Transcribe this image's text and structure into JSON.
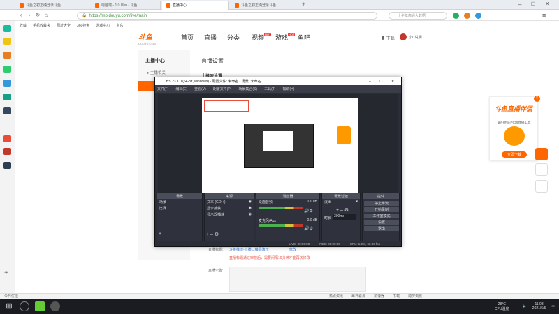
{
  "browser": {
    "tabs": [
      {
        "label": "斗鱼之初正确登录斗鱼"
      },
      {
        "label": "电脑端 - 1.0 Ubu - 斗鱼"
      },
      {
        "label": "直播中心"
      },
      {
        "label": "斗鱼之初正确登录斗鱼"
      }
    ],
    "url": "https://mp.douyu.com/live/main",
    "search_placeholder": "上半年高通大数据",
    "bookmarks": [
      "收藏",
      "手机收藏夹",
      "网址大全",
      "360搜索",
      "游戏中心",
      "京东"
    ]
  },
  "douyu": {
    "logo_text": "斗鱼",
    "logo_sub": "DOUYU.COM",
    "nav": [
      "首页",
      "直播",
      "分类",
      "视频",
      "游戏",
      "鱼吧"
    ],
    "hot_badge": "HOT",
    "download": "下载",
    "user": "小C说明"
  },
  "sidebar": {
    "title": "主播中心",
    "items": [
      "主播相关"
    ]
  },
  "main": {
    "section_title": "直播设置",
    "sub_title": "推流设置"
  },
  "obs": {
    "title": "OBS 23.1.0 (64-bit, windows) - 配置文件: 未命名 - 场景: 未命名",
    "menu": [
      "文件(F)",
      "编辑(E)",
      "查看(V)",
      "配置文件(P)",
      "场景集合(S)",
      "工具(T)",
      "帮助(H)"
    ],
    "docks": {
      "scenes": {
        "title": "场景",
        "items": [
          "场景",
          "比赛"
        ]
      },
      "sources": {
        "title": "来源",
        "items": [
          "文本 (GDI+)",
          "显示捕获",
          "显示器捕获"
        ]
      },
      "mixer": {
        "title": "混音器",
        "channels": [
          {
            "name": "桌面音频",
            "db": "0.0 dB"
          },
          {
            "name": "麦克风/Aux",
            "db": "0.0 dB"
          }
        ]
      },
      "transitions": {
        "title": "场景过渡",
        "type": "淡出",
        "duration_label": "时长",
        "duration": "300ms"
      },
      "controls": {
        "title": "控件",
        "buttons": [
          "停止推流",
          "开始录制",
          "工作室模式",
          "设置",
          "退出"
        ]
      }
    },
    "status": {
      "live": "LIVE: 00:00:00",
      "rec": "REC: 00:00:00",
      "cpu": "CPU: 1.9%, 60.00 fps"
    }
  },
  "below_obs": {
    "room_title_label": "直播标题:",
    "room_title_value": "斗鱼推流-直播二维码演示",
    "edit": "修改",
    "warning": "直播标题通过审核后，需要间隔10分钟才能再次修改",
    "notice_label": "直播公告:"
  },
  "ad": {
    "title": "斗鱼直播伴侣",
    "sub": "最好用的PC端直播工具",
    "button": "立即下载"
  },
  "status_bar": {
    "left": "今日优选",
    "items": [
      "热点资讯",
      "每日看点",
      "加速器",
      "下载",
      "跨屏浏览"
    ]
  },
  "taskbar": {
    "weather": "28°C",
    "weather_sub": "CPU温度",
    "time": "11:08",
    "date": "2021/6/5"
  },
  "colors": {
    "brand": "#ff6600",
    "obs_bg": "#2b2e38",
    "taskbar": "#1a1c21"
  }
}
